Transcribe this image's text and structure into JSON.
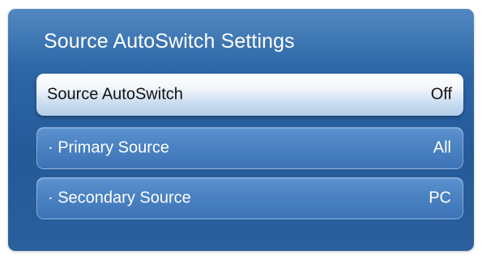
{
  "dialog": {
    "title": "Source AutoSwitch Settings"
  },
  "menu": {
    "items": [
      {
        "label": "Source AutoSwitch",
        "value": "Off"
      },
      {
        "label": "· Primary Source",
        "value": "All"
      },
      {
        "label": "· Secondary Source",
        "value": "PC"
      }
    ]
  },
  "colors": {
    "panel_background": "#2b64a4",
    "selected_item": "#ffffff",
    "item_background": "#4b82c2",
    "text_light": "#ffffff",
    "text_dark": "#111111"
  }
}
